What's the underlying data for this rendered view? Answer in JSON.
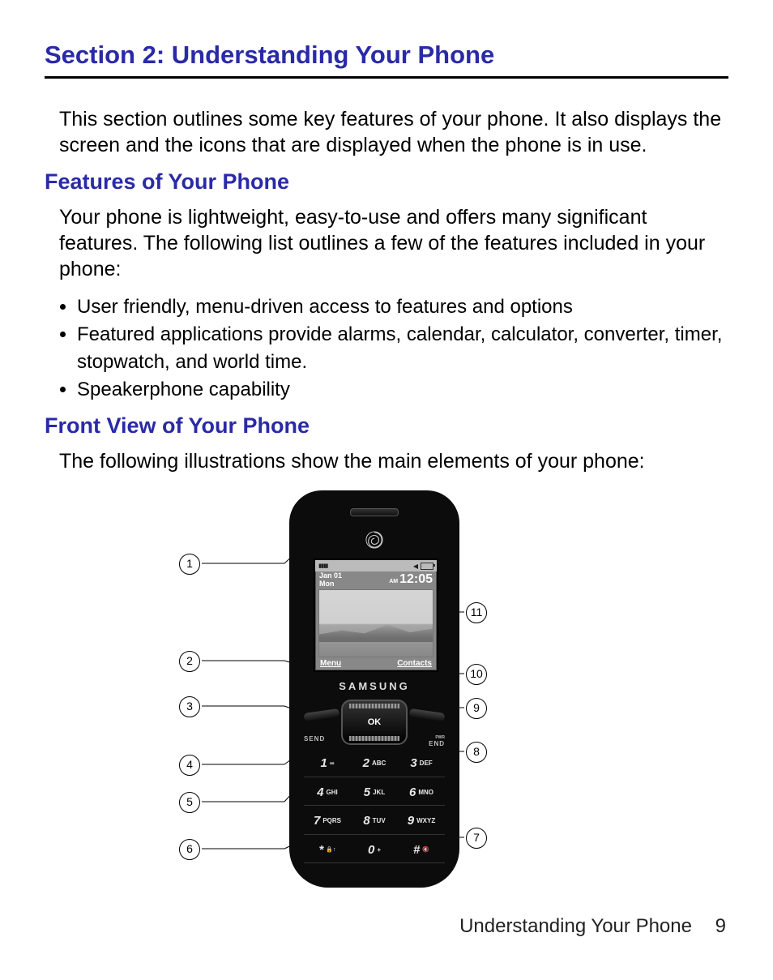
{
  "section_title": "Section 2: Understanding Your Phone",
  "intro": "This section outlines some key features of your phone. It also displays the screen and the icons that are displayed when the phone is in use.",
  "h_features": "Features of Your Phone",
  "features_intro": "Your phone is lightweight, easy-to-use and offers many significant features. The following list outlines a few of the features included in your phone:",
  "features": [
    "User friendly, menu-driven access to features and options",
    "Featured applications provide alarms, calendar, calculator, converter, timer, stopwatch, and world time.",
    "Speakerphone capability"
  ],
  "h_front": "Front View of Your Phone",
  "front_intro": "The following illustrations show the main elements of your phone:",
  "phone": {
    "brand": "SAMSUNG",
    "screen": {
      "date_line1": "Jan 01",
      "date_line2": "Mon",
      "ampm": "AM",
      "time": "12:05",
      "soft_left": "Menu",
      "soft_right": "Contacts"
    },
    "dpad_ok": "OK",
    "send_label": "SEND",
    "end_small": "PWR",
    "end_label": "END",
    "keys": [
      {
        "num": "1",
        "sub": "",
        "icon": "∞"
      },
      {
        "num": "2",
        "sub": "ABC"
      },
      {
        "num": "3",
        "sub": "DEF"
      },
      {
        "num": "4",
        "sub": "GHI"
      },
      {
        "num": "5",
        "sub": "JKL"
      },
      {
        "num": "6",
        "sub": "MNO"
      },
      {
        "num": "7",
        "sub": "PQRS"
      },
      {
        "num": "8",
        "sub": "TUV"
      },
      {
        "num": "9",
        "sub": "WXYZ"
      },
      {
        "num": "*",
        "sub": "",
        "icon": "🔒↑"
      },
      {
        "num": "0",
        "sub": "+"
      },
      {
        "num": "#",
        "sub": "",
        "icon": "🔇"
      }
    ]
  },
  "callouts": [
    "1",
    "2",
    "3",
    "4",
    "5",
    "6",
    "7",
    "8",
    "9",
    "10",
    "11"
  ],
  "footer_label": "Understanding Your Phone",
  "footer_page": "9"
}
